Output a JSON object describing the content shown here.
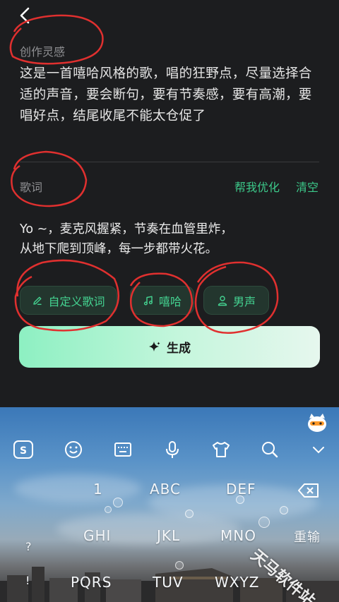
{
  "header": {
    "back_icon": "chevron-left-icon"
  },
  "inspiration": {
    "label": "创作灵感",
    "text": "这是一首嘻哈风格的歌，唱的狂野点，尽量选择合适的声音，要会断句，要有节奏感，要有高潮，要唱好点，结尾收尾不能太仓促了"
  },
  "lyrics": {
    "label": "歌词",
    "optimize_label": "帮我优化",
    "clear_label": "清空",
    "lines": [
      "Yo ~，麦克风握紧，节奏在血管里炸，",
      "从地下爬到顶峰，每一步都带火花。"
    ]
  },
  "chips": {
    "custom_lyrics": "自定义歌词",
    "genre": "嘻哈",
    "voice": "男声"
  },
  "generate_label": "生成",
  "keyboard": {
    "keys_row1": {
      "k1": "1",
      "k2": "ABC",
      "k3": "DEF"
    },
    "keys_row2": {
      "k1": "GHI",
      "k2": "JKL",
      "k3": "MNO",
      "k4": "重输"
    },
    "keys_row3": {
      "k1": "PQRS",
      "k2": "TUV",
      "k3": "WXYZ"
    },
    "punct_1": "?",
    "punct_2": "!"
  },
  "watermark": "天马软件站",
  "colors": {
    "accent_green": "#3cc98a",
    "background": "#1c1d1f"
  }
}
